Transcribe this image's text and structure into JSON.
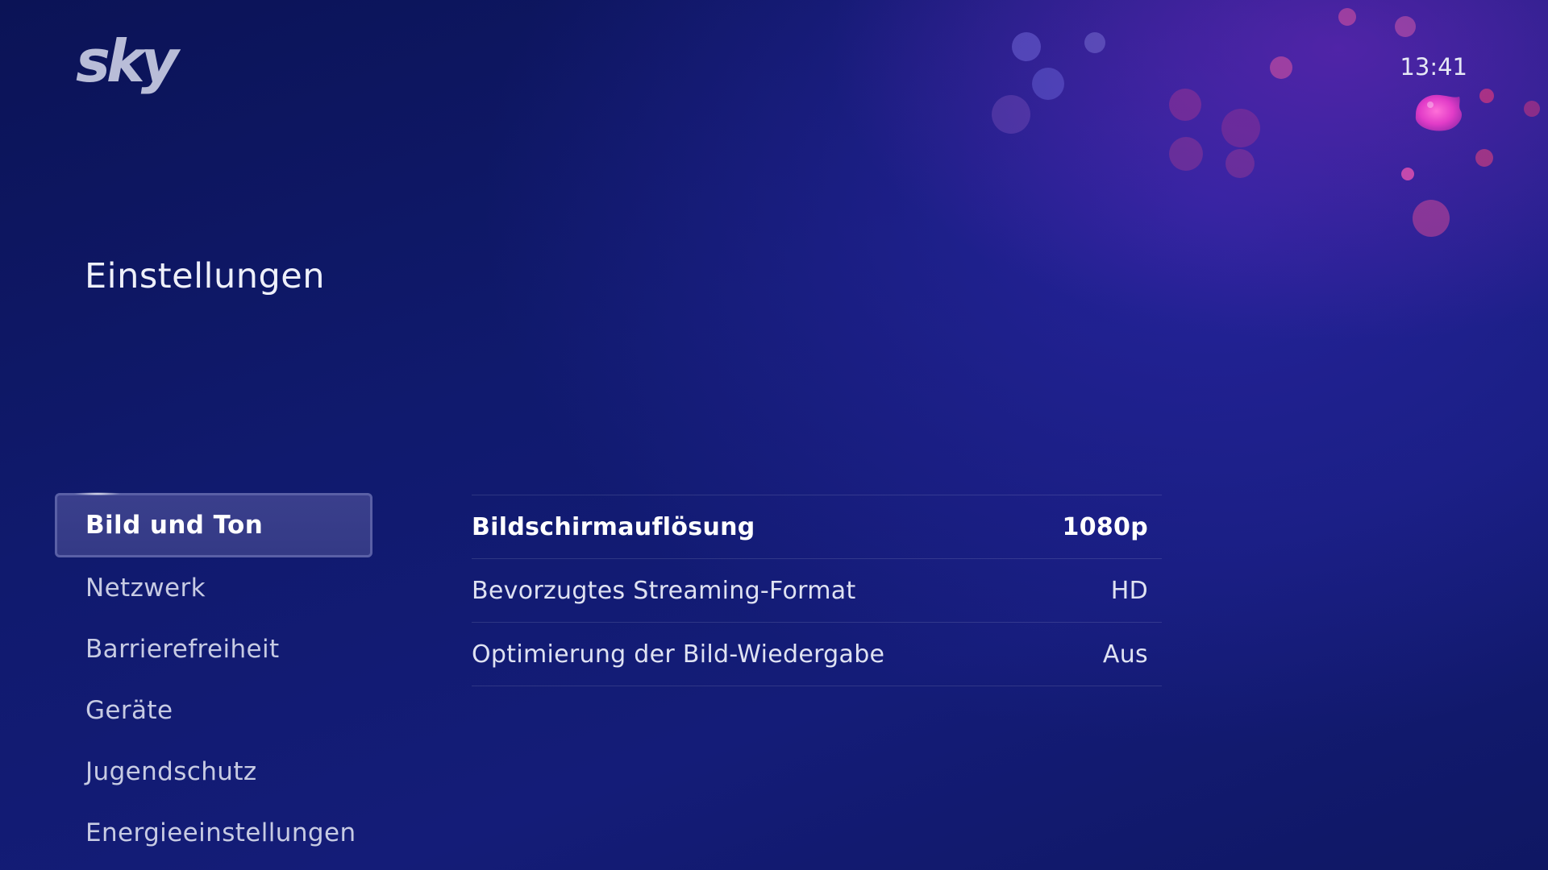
{
  "header": {
    "logo_text": "sky",
    "clock": "13:41",
    "avatar_icon": "profile-avatar-icon"
  },
  "page": {
    "title": "Einstellungen"
  },
  "sidebar": {
    "items": [
      {
        "label": "Bild und Ton",
        "selected": true
      },
      {
        "label": "Netzwerk",
        "selected": false
      },
      {
        "label": "Barrierefreiheit",
        "selected": false
      },
      {
        "label": "Geräte",
        "selected": false
      },
      {
        "label": "Jugendschutz",
        "selected": false
      },
      {
        "label": "Energieeinstellungen",
        "selected": false
      }
    ]
  },
  "settings": {
    "rows": [
      {
        "label": "Bildschirmauflösung",
        "value": "1080p"
      },
      {
        "label": "Bevorzugtes Streaming-Format",
        "value": "HD"
      },
      {
        "label": "Optimierung der Bild-Wiedergabe",
        "value": "Aus"
      }
    ]
  },
  "colors": {
    "background": "#101a6e",
    "selected_item": "#3a3f8c",
    "accent_pink": "#e23cc8"
  }
}
